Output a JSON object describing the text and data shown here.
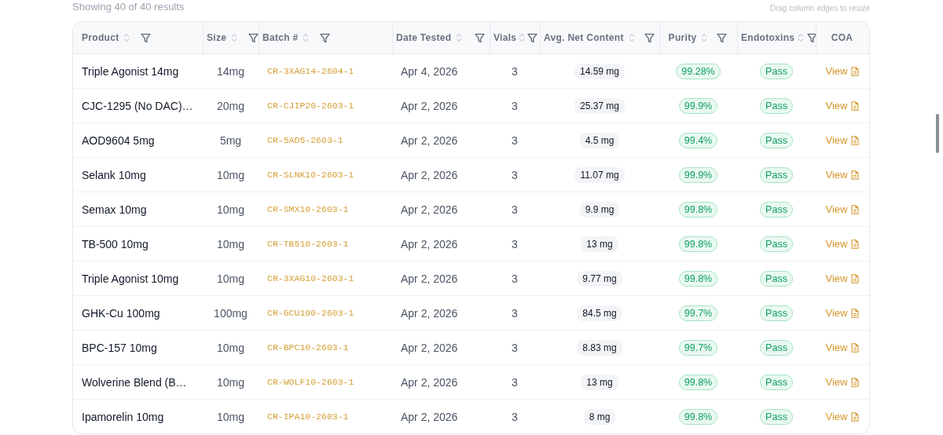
{
  "summary": "Showing 40 of 40 results",
  "hint": "Drag column edges to resize",
  "columns": [
    {
      "label": "Product",
      "sortable": true,
      "filterable": true
    },
    {
      "label": "Size",
      "sortable": true,
      "filterable": true
    },
    {
      "label": "Batch #",
      "sortable": true,
      "filterable": true
    },
    {
      "label": "Date Tested",
      "sortable": true,
      "filterable": true
    },
    {
      "label": "Vials",
      "sortable": true,
      "filterable": true
    },
    {
      "label": "Avg. Net Content",
      "sortable": true,
      "filterable": true
    },
    {
      "label": "Purity",
      "sortable": true,
      "filterable": true
    },
    {
      "label": "Endotoxins",
      "sortable": true,
      "filterable": true
    },
    {
      "label": "COA",
      "sortable": false,
      "filterable": false
    }
  ],
  "rows": [
    {
      "product": "Triple Agonist 14mg",
      "size": "14mg",
      "batch": "CR-3XAG14-2604-1",
      "date": "Apr 4, 2026",
      "vials": "3",
      "content": "14.59 mg",
      "purity": "99.28%",
      "endotoxins": "Pass",
      "coa": "View"
    },
    {
      "product": "CJC-1295 (No DAC)…",
      "size": "20mg",
      "batch": "CR-CJIP20-2603-1",
      "date": "Apr 2, 2026",
      "vials": "3",
      "content": "25.37 mg",
      "purity": "99.9%",
      "endotoxins": "Pass",
      "coa": "View"
    },
    {
      "product": "AOD9604 5mg",
      "size": "5mg",
      "batch": "CR-5AD5-2603-1",
      "date": "Apr 2, 2026",
      "vials": "3",
      "content": "4.5 mg",
      "purity": "99.4%",
      "endotoxins": "Pass",
      "coa": "View"
    },
    {
      "product": "Selank 10mg",
      "size": "10mg",
      "batch": "CR-SLNK10-2603-1",
      "date": "Apr 2, 2026",
      "vials": "3",
      "content": "11.07 mg",
      "purity": "99.9%",
      "endotoxins": "Pass",
      "coa": "View"
    },
    {
      "product": "Semax 10mg",
      "size": "10mg",
      "batch": "CR-SMX10-2603-1",
      "date": "Apr 2, 2026",
      "vials": "3",
      "content": "9.9 mg",
      "purity": "99.8%",
      "endotoxins": "Pass",
      "coa": "View"
    },
    {
      "product": "TB-500 10mg",
      "size": "10mg",
      "batch": "CR-TB510-2603-1",
      "date": "Apr 2, 2026",
      "vials": "3",
      "content": "13 mg",
      "purity": "99.8%",
      "endotoxins": "Pass",
      "coa": "View"
    },
    {
      "product": "Triple Agonist 10mg",
      "size": "10mg",
      "batch": "CR-3XAG10-2603-1",
      "date": "Apr 2, 2026",
      "vials": "3",
      "content": "9.77 mg",
      "purity": "99.8%",
      "endotoxins": "Pass",
      "coa": "View"
    },
    {
      "product": "GHK-Cu 100mg",
      "size": "100mg",
      "batch": "CR-GCU100-2603-1",
      "date": "Apr 2, 2026",
      "vials": "3",
      "content": "84.5 mg",
      "purity": "99.7%",
      "endotoxins": "Pass",
      "coa": "View"
    },
    {
      "product": "BPC-157 10mg",
      "size": "10mg",
      "batch": "CR-BPC10-2603-1",
      "date": "Apr 2, 2026",
      "vials": "3",
      "content": "8.83 mg",
      "purity": "99.7%",
      "endotoxins": "Pass",
      "coa": "View"
    },
    {
      "product": "Wolverine Blend (B…",
      "size": "10mg",
      "batch": "CR-WOLF10-2603-1",
      "date": "Apr 2, 2026",
      "vials": "3",
      "content": "13 mg",
      "purity": "99.8%",
      "endotoxins": "Pass",
      "coa": "View"
    },
    {
      "product": "Ipamorelin 10mg",
      "size": "10mg",
      "batch": "CR-IPA10-2603-1",
      "date": "Apr 2, 2026",
      "vials": "3",
      "content": "8 mg",
      "purity": "99.8%",
      "endotoxins": "Pass",
      "coa": "View"
    }
  ]
}
